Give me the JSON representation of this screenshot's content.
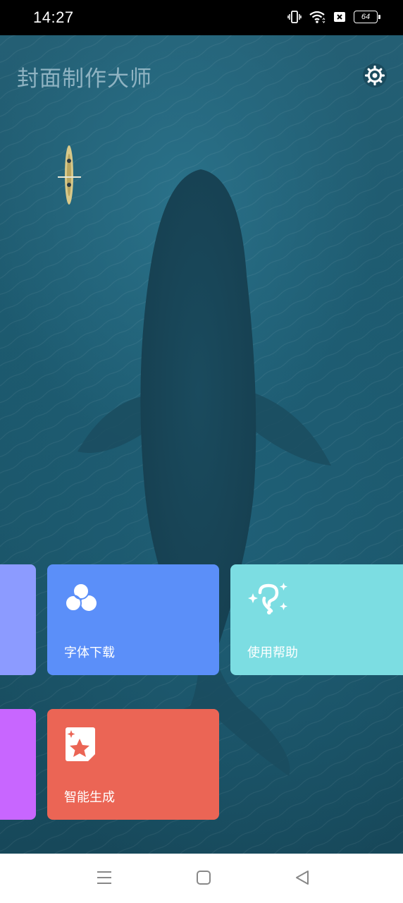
{
  "status_bar": {
    "time": "14:27",
    "battery_level": "64",
    "icons": [
      "vibrate-icon",
      "wifi-icon",
      "no-sim-icon",
      "battery-icon"
    ]
  },
  "header": {
    "title": "封面制作大师",
    "settings_icon": "gear-icon"
  },
  "tiles": [
    {
      "label": "",
      "color": "#8c9bff",
      "icon": ""
    },
    {
      "label": "字体下载",
      "color": "#5b8ff9",
      "icon": "font-download-icon"
    },
    {
      "label": "使用帮助",
      "color": "#7cdde2",
      "icon": "help-sparkle-icon"
    },
    {
      "label": "",
      "color": "#c866ff",
      "icon": ""
    },
    {
      "label": "智能生成",
      "color": "#eb6555",
      "icon": "magic-star-icon"
    }
  ],
  "nav_bar": {
    "items": [
      "menu-icon",
      "home-icon",
      "back-icon"
    ]
  }
}
